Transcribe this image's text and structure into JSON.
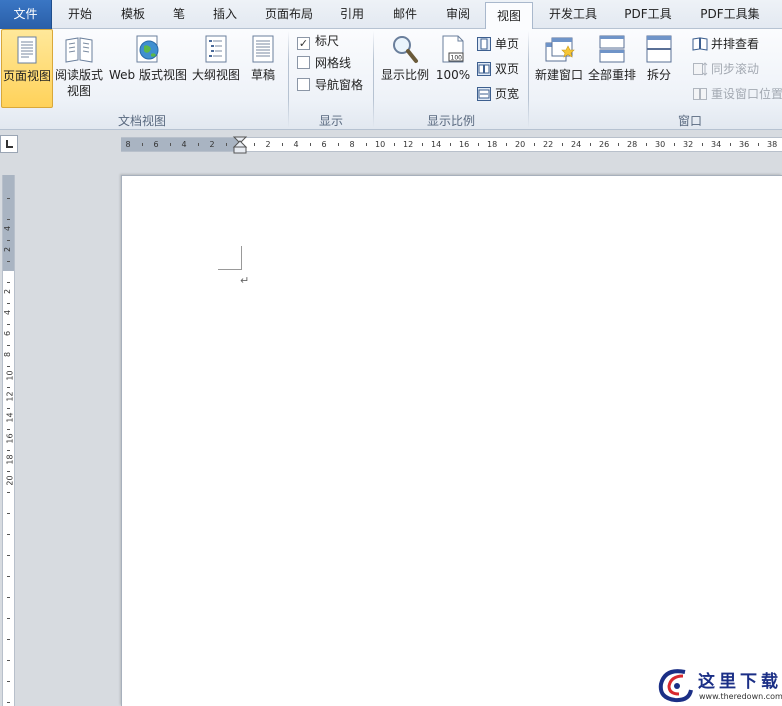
{
  "tabs": [
    {
      "label": "文件"
    },
    {
      "label": "开始"
    },
    {
      "label": "模板"
    },
    {
      "label": "笔"
    },
    {
      "label": "插入"
    },
    {
      "label": "页面布局"
    },
    {
      "label": "引用"
    },
    {
      "label": "邮件"
    },
    {
      "label": "审阅"
    },
    {
      "label": "视图"
    },
    {
      "label": "开发工具"
    },
    {
      "label": "PDF工具"
    },
    {
      "label": "PDF工具集"
    }
  ],
  "ribbon": {
    "doc_views": {
      "label": "文档视图",
      "print_layout": "页面视图",
      "full_screen_reading_1": "阅读版式",
      "full_screen_reading_2": "视图",
      "web_layout": "Web 版式视图",
      "outline": "大纲视图",
      "draft": "草稿"
    },
    "show": {
      "label": "显示",
      "ruler": "标尺",
      "ruler_checked": "✓",
      "gridlines": "网格线",
      "nav_pane": "导航窗格"
    },
    "zoom": {
      "label": "显示比例",
      "zoom": "显示比例",
      "hundred": "100%",
      "one_page": "单页",
      "two_pages": "双页",
      "page_width": "页宽",
      "zoom_icon_text": "100"
    },
    "window": {
      "label": "窗口",
      "new_window": "新建窗口",
      "arrange_all": "全部重排",
      "split": "拆分",
      "side_by_side": "并排查看",
      "sync_scroll": "同步滚动",
      "reset_position": "重设窗口位置"
    }
  },
  "hruler": {
    "labels": [
      "8",
      "6",
      "4",
      "2",
      "2",
      "4",
      "6",
      "8",
      "10",
      "12",
      "14",
      "16",
      "18",
      "20",
      "22",
      "24",
      "26",
      "28",
      "30",
      "32",
      "34",
      "36",
      "38"
    ]
  },
  "vruler": {
    "labels": [
      "4",
      "2",
      "2",
      "4",
      "6",
      "8",
      "10",
      "12",
      "14",
      "16",
      "18",
      "20"
    ]
  },
  "document": {
    "paragraph_mark": "↵"
  },
  "watermark": {
    "title": "这里下载",
    "url": "www.theredown.com"
  }
}
